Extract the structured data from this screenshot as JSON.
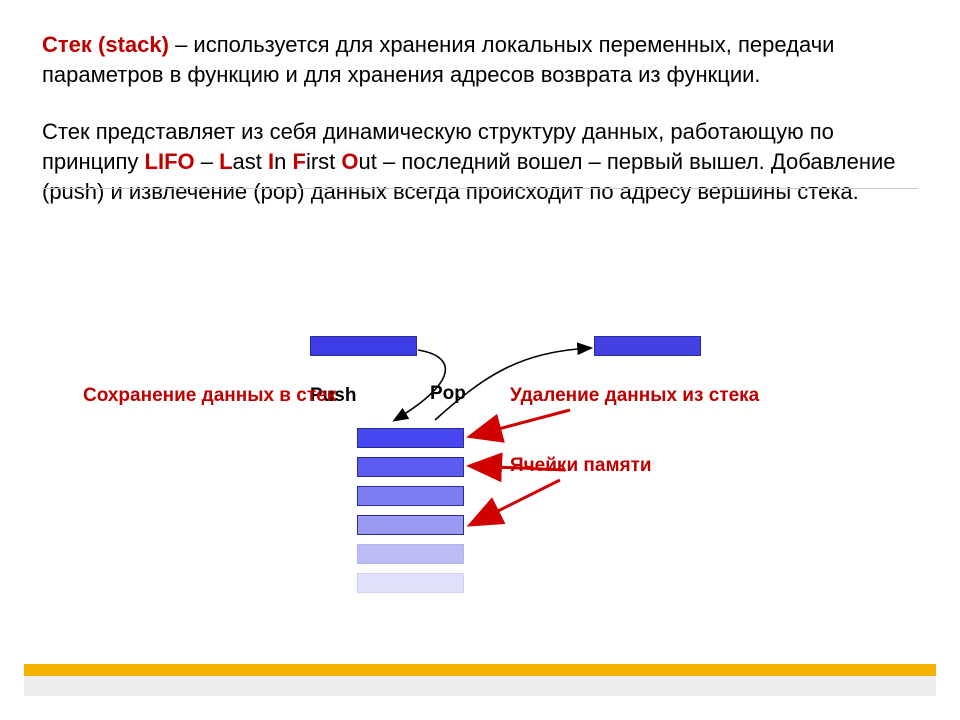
{
  "paragraph1": {
    "title": "Стек (stack)",
    "rest": " – используется для хранения локальных переменных, передачи параметров в функцию и для хранения адресов возврата из функции."
  },
  "paragraph2": {
    "pre": "Стек представляет из себя динамическую структуру данных, работающую по принципу ",
    "lifo": "LIFO",
    "sep1": " – ",
    "L": "L",
    "ast": "ast ",
    "I": "I",
    "n": "n ",
    "F": "F",
    "irst": "irst ",
    "O": "O",
    "ut": "ut",
    "post": " – последний вошел – первый вышел. Добавление (push) и извлечение (pop) данных всегда происходит по адресу вершины стека."
  },
  "labels": {
    "push": "Push",
    "pop": "Pop",
    "save": "Сохранение данных в стек",
    "delete": "Удаление данных из стека",
    "memory": "Ячейки памяти"
  },
  "chart_data": {
    "type": "diagram",
    "title": "Стек (stack) — LIFO",
    "operations": [
      "Push",
      "Pop"
    ],
    "stack_cells": 6,
    "annotations": {
      "push_description": "Сохранение данных в стек",
      "pop_description": "Удаление данных из стека",
      "cells_label": "Ячейки памяти"
    }
  }
}
